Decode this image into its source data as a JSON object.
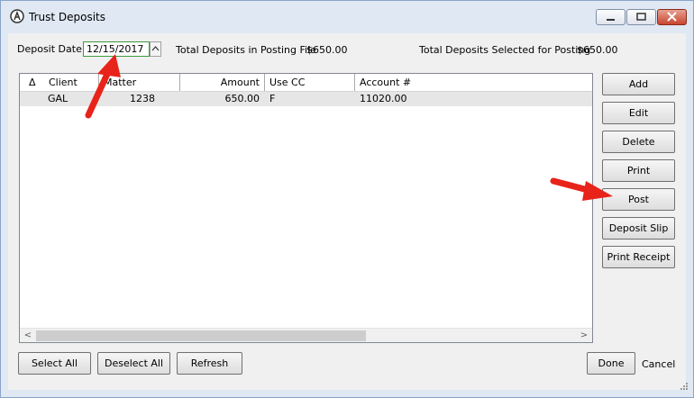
{
  "window": {
    "title": "Trust Deposits"
  },
  "deposit_date": {
    "label": "Deposit Date",
    "value": "12/15/2017"
  },
  "totals": {
    "posting_file_label": "Total Deposits in Posting File",
    "posting_file_value": "$650.00",
    "selected_label": "Total Deposits Selected for Posting",
    "selected_value": "$650.00"
  },
  "grid": {
    "columns": [
      "Client",
      "Matter",
      "Amount",
      "Use CC",
      "Account #"
    ],
    "sort_glyph": "Δ",
    "rows": [
      {
        "client": "GAL",
        "matter": "1238",
        "amount": "650.00",
        "use_cc": "F",
        "account": "11020.00"
      }
    ]
  },
  "side_buttons": [
    "Add",
    "Edit",
    "Delete",
    "Print",
    "Post",
    "Deposit Slip",
    "Print Receipt"
  ],
  "bottom_buttons": {
    "select_all": "Select All",
    "deselect_all": "Deselect All",
    "refresh": "Refresh"
  },
  "footer": {
    "done": "Done",
    "cancel": "Cancel"
  },
  "colors": {
    "annotation_arrow": "#e8231a",
    "date_focus_border": "#3b9a3b",
    "title_bar": "#dfe8f3"
  },
  "icons": [
    "app-logo-icon",
    "minimize-icon",
    "maximize-icon",
    "close-icon",
    "spin-up-icon",
    "scroll-left-icon",
    "scroll-right-icon",
    "resize-grip-icon"
  ]
}
